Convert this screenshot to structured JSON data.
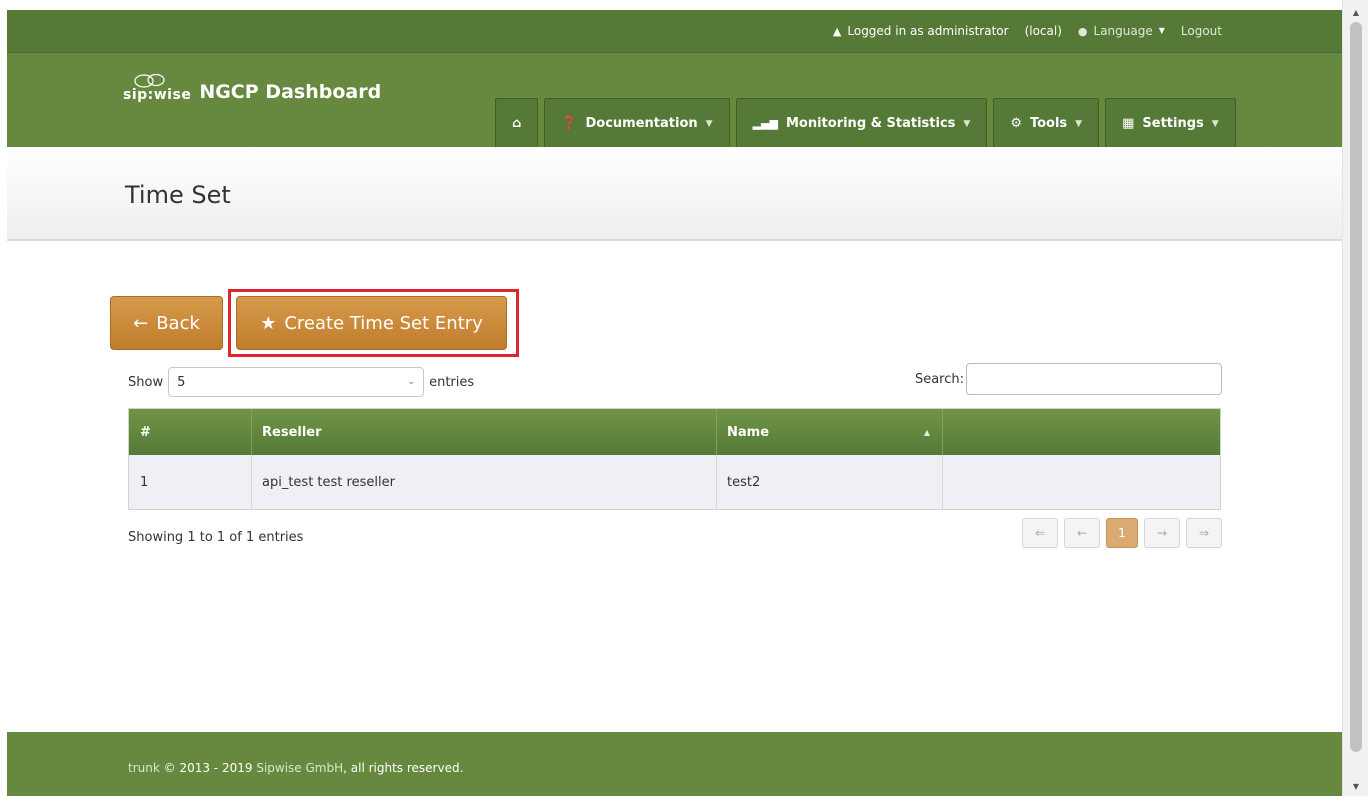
{
  "topbar": {
    "logged_in": "Logged in as administrator",
    "realm": "(local)",
    "language": "Language",
    "logout": "Logout"
  },
  "header": {
    "brand": "sip:wise",
    "title": "NGCP Dashboard",
    "nav": {
      "home_icon": "home-icon",
      "documentation": "Documentation",
      "monitoring": "Monitoring & Statistics",
      "tools": "Tools",
      "settings": "Settings"
    }
  },
  "page": {
    "title": "Time Set"
  },
  "actions": {
    "back": "Back",
    "create": "Create Time Set Entry"
  },
  "table_controls": {
    "show_label": "Show",
    "show_value": "5",
    "entries_label": "entries",
    "search_label": "Search:",
    "search_value": ""
  },
  "table": {
    "headers": [
      "#",
      "Reseller",
      "Name",
      ""
    ],
    "rows": [
      [
        "1",
        "api_test test reseller",
        "test2",
        ""
      ]
    ]
  },
  "info": "Showing 1 to 1 of 1 entries",
  "pagination": {
    "first": "⇐",
    "prev": "←",
    "current": "1",
    "next": "→",
    "last": "⇒"
  },
  "footer": {
    "version": "trunk",
    "copyright": "© 2013 - 2019",
    "company": "Sipwise GmbH",
    "rights": ", all rights reserved."
  },
  "colors": {
    "header_green": "#66893f",
    "topbar_green": "#557a38",
    "button_orange": "#c98a3a",
    "highlight_red": "#e0252a"
  }
}
